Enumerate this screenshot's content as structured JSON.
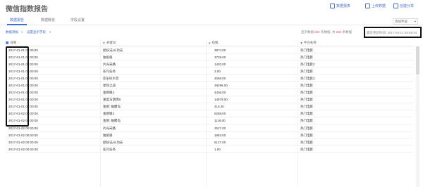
{
  "header": {
    "title": "微信指数报告",
    "actions": [
      {
        "label": "数据报表",
        "icon": "report-icon"
      },
      {
        "label": "上传数据",
        "icon": "upload-icon"
      },
      {
        "label": "创建分享",
        "icon": "share-icon"
      }
    ]
  },
  "tabs": [
    {
      "label": "数据报告",
      "active": true
    },
    {
      "label": "数据概览",
      "active": false
    },
    {
      "label": "字段设置",
      "active": false
    }
  ],
  "field_select": {
    "label": "添加字段"
  },
  "toolbar": {
    "link1": "数据源报",
    "link2": "设置显示字段",
    "stats_prefix": "显示数据",
    "stats_count1": "604",
    "stats_mid": "条数据, 共",
    "stats_count2": "604",
    "stats_suffix": "条数据",
    "updated": "最近更新时间: 2017-04-12 09:59:44"
  },
  "table": {
    "columns": [
      {
        "label": "日期",
        "icon": "calendar-icon"
      },
      {
        "label": "关键词",
        "icon": "text-icon"
      },
      {
        "label": "指数",
        "icon": "number-icon"
      },
      {
        "label": "平台名称",
        "icon": "text-icon"
      }
    ],
    "rows": [
      [
        "2017-01-01 00:00:00",
        "捉妖记/从功夫",
        "3974.00",
        "热门电影"
      ],
      [
        "2017-01-01 00:00:00",
        "独角兽",
        "3738.00",
        "热门电影"
      ],
      [
        "2017-01-01 00:00:00",
        "片光宋路",
        "1420.00",
        "热门电影2"
      ],
      [
        "2017-01-01 00:00:00",
        "非凡任务",
        "2.00",
        "热门电影"
      ],
      [
        "2017-01-01 00:00:00",
        "欢乐好声音",
        "4068.00",
        "热门电影2"
      ],
      [
        "2017-01-01 00:00:00",
        "星际之战",
        "29296.00",
        "热门电影"
      ],
      [
        "2017-01-01 00:00:00",
        "金刚狼3",
        "4436.00",
        "热门电影"
      ],
      [
        "2017-01-01 00:00:00",
        "速度与激情8",
        "14979.00",
        "热门电影"
      ],
      [
        "2017-01-01 00:00:00",
        "金刚: 骷髅岛",
        "415.00",
        "热门电影"
      ],
      [
        "2017-01-02 00:00:00",
        "金刚狼3",
        "5288.00",
        "热门电影"
      ],
      [
        "2017-01-02 00:00:00",
        "金刚: 骷髅岛",
        "1116.00",
        "热门电影"
      ],
      [
        "2017-01-02 00:00:00",
        "片光宋路",
        "2527.00",
        "热门电影"
      ],
      [
        "2017-01-02 00:00:00",
        "独角兽",
        "1863.00",
        "热门电影"
      ],
      [
        "2017-01-02 00:00:00",
        "捉妖记/从功夫",
        "6127.00",
        "热门电影"
      ],
      [
        "2017-01-02 00:00:00",
        "非凡任务",
        "1.00",
        "热门电影"
      ]
    ]
  }
}
